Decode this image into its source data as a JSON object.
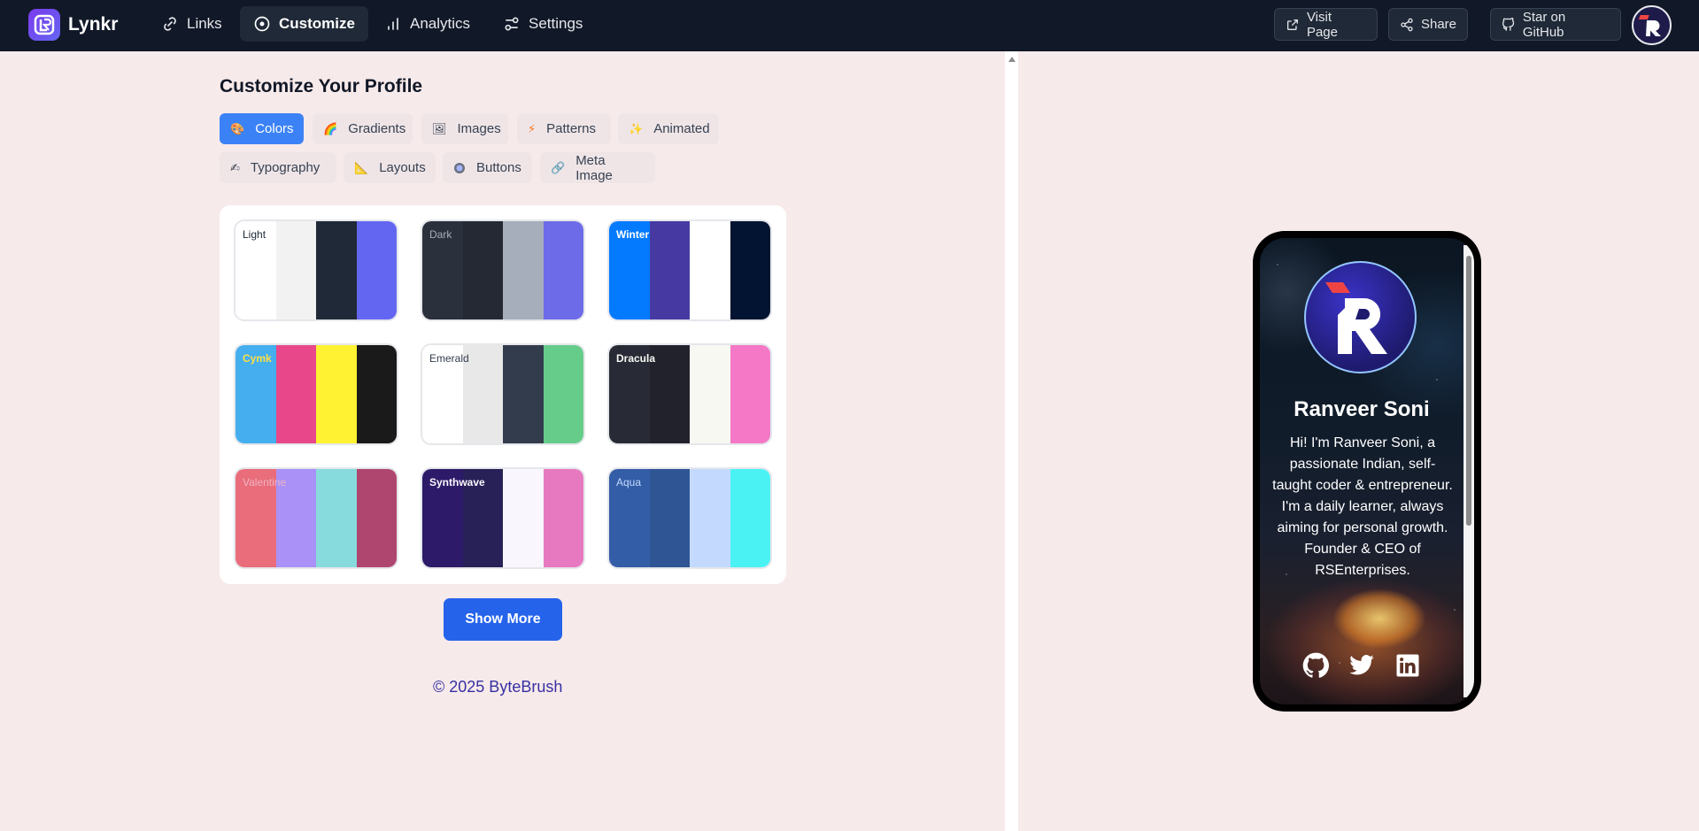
{
  "app": {
    "name": "Lynkr"
  },
  "nav": [
    {
      "label": "Links",
      "icon": "link-icon"
    },
    {
      "label": "Customize",
      "icon": "compass-icon",
      "active": true
    },
    {
      "label": "Analytics",
      "icon": "bar-chart-icon"
    },
    {
      "label": "Settings",
      "icon": "sliders-icon"
    }
  ],
  "top_actions": {
    "visit": "Visit Page",
    "share": "Share",
    "github": "Star on GitHub"
  },
  "page": {
    "title": "Customize Your Profile"
  },
  "tabs": [
    {
      "label": "Colors",
      "icon": "palette-icon",
      "active": true
    },
    {
      "label": "Gradients",
      "icon": "rainbow-icon"
    },
    {
      "label": "Images",
      "icon": "picture-icon"
    },
    {
      "label": "Patterns",
      "icon": "lightning-icon"
    },
    {
      "label": "Animated",
      "icon": "sparkles-icon"
    },
    {
      "label": "Typography",
      "icon": "writing-hand-icon"
    },
    {
      "label": "Layouts",
      "icon": "triangle-ruler-icon"
    },
    {
      "label": "Buttons",
      "icon": "button-icon"
    },
    {
      "label": "Meta Image",
      "icon": "link-icon"
    }
  ],
  "themes": [
    {
      "name": "Light",
      "label_color": "#1f2937",
      "colors": [
        "#ffffff",
        "#f2f2f2",
        "#1f2937",
        "#6366f1"
      ]
    },
    {
      "name": "Dark",
      "label_color": "#a6adbb",
      "colors": [
        "#2a303c",
        "#242933",
        "#a6adbb",
        "#6d6be8"
      ]
    },
    {
      "name": "Winter",
      "label_color": "#ffffff",
      "colors": [
        "#047aff",
        "#463aa2",
        "#ffffff",
        "#021431"
      ]
    },
    {
      "name": "Cymk",
      "label_color": "#fde047",
      "colors": [
        "#45aeee",
        "#e8488a",
        "#fff232",
        "#1a1a1a"
      ]
    },
    {
      "name": "Emerald",
      "label_color": "#333c4d",
      "colors": [
        "#ffffff",
        "#e8e8e8",
        "#333c4d",
        "#66cc8a"
      ]
    },
    {
      "name": "Dracula",
      "label_color": "#f8f8f2",
      "colors": [
        "#282a36",
        "#21222c",
        "#f8f8f2",
        "#f478c6"
      ]
    },
    {
      "name": "Valentine",
      "label_color": "#f0b3c1",
      "colors": [
        "#e96d7b",
        "#a991f7",
        "#88dbdd",
        "#af4670"
      ]
    },
    {
      "name": "Synthwave",
      "label_color": "#f9f7fd",
      "colors": [
        "#2d1b69",
        "#282158",
        "#f9f7fd",
        "#e779c1"
      ]
    },
    {
      "name": "Aqua",
      "label_color": "#c3dafe",
      "colors": [
        "#345da7",
        "#2f5594",
        "#c3dafe",
        "#4bf2f4"
      ]
    }
  ],
  "show_more": "Show More",
  "footer": "© 2025 ByteBrush",
  "profile": {
    "name": "Ranveer Soni",
    "bio": "Hi! I'm Ranveer Soni, a passionate Indian, self-taught coder & entrepreneur. I'm a daily learner, always aiming for personal growth. Founder & CEO of RSEnterprises.",
    "socials": [
      "github-icon",
      "twitter-icon",
      "linkedin-icon"
    ]
  }
}
